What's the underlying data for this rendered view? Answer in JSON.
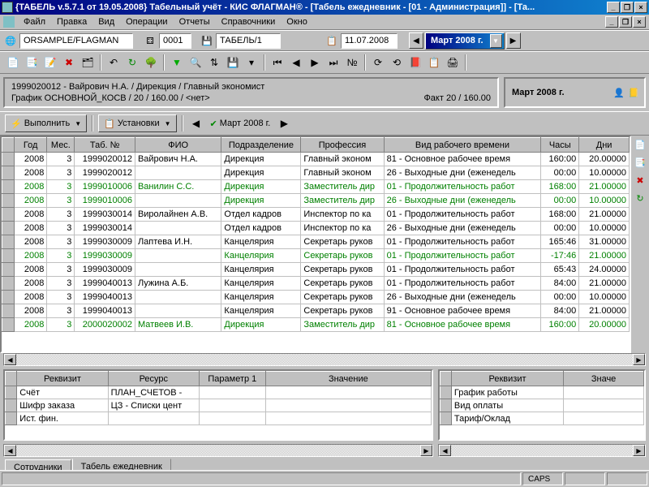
{
  "titlebar": {
    "text": "{ТАБЕЛЬ v.5.7.1 от 19.05.2008} Табельный учёт - КИС ФЛАГМАН® - [Табель ежедневник - [01 - Администрация]] - [Та..."
  },
  "menu": {
    "file": "Файл",
    "edit": "Правка",
    "view": "Вид",
    "ops": "Операции",
    "reports": "Отчеты",
    "refs": "Справочники",
    "window": "Окно"
  },
  "toolbar1": {
    "db": "ORSAMPLE/FLAGMAN",
    "code": "0001",
    "path": "ТАБЕЛЬ/1",
    "date": "11.07.2008",
    "period": "Март 2008 г."
  },
  "info": {
    "line1": "1999020012 - Вайрович Н.А.   /   Дирекция   /   Главный экономист",
    "line2": "График ОСНОВНОЙ_КОСВ / 20 / 160.00 / <нет>",
    "fact": "Факт 20 / 160.00",
    "period": "Март 2008 г."
  },
  "actions": {
    "execute": "Выполнить",
    "settings": "Установки",
    "month": "Март 2008 г."
  },
  "grid": {
    "headers": [
      "Год",
      "Мес.",
      "Таб. №",
      "ФИО",
      "Подразделение",
      "Профессия",
      "Вид рабочего времени",
      "Часы",
      "Дни"
    ],
    "rows": [
      {
        "g": false,
        "c": [
          "2008",
          "3",
          "1999020012",
          "Вайрович Н.А.",
          "Дирекция",
          "Главный эконом",
          "81 - Основное рабочее время",
          "160:00",
          "20.00000"
        ]
      },
      {
        "g": false,
        "c": [
          "2008",
          "3",
          "1999020012",
          "",
          "Дирекция",
          "Главный эконом",
          "26 - Выходные дни (еженедель",
          "00:00",
          "10.00000"
        ]
      },
      {
        "g": true,
        "c": [
          "2008",
          "3",
          "1999010006",
          "Ванилин С.С.",
          "Дирекция",
          "Заместитель дир",
          "01 - Продолжительность работ",
          "168:00",
          "21.00000"
        ]
      },
      {
        "g": true,
        "c": [
          "2008",
          "3",
          "1999010006",
          "",
          "Дирекция",
          "Заместитель дир",
          "26 - Выходные дни (еженедель",
          "00:00",
          "10.00000"
        ]
      },
      {
        "g": false,
        "c": [
          "2008",
          "3",
          "1999030014",
          "Виролайнен А.В.",
          "Отдел кадров",
          "Инспектор по ка",
          "01 - Продолжительность работ",
          "168:00",
          "21.00000"
        ]
      },
      {
        "g": false,
        "c": [
          "2008",
          "3",
          "1999030014",
          "",
          "Отдел кадров",
          "Инспектор по ка",
          "26 - Выходные дни (еженедель",
          "00:00",
          "10.00000"
        ]
      },
      {
        "g": false,
        "c": [
          "2008",
          "3",
          "1999030009",
          "Лаптева И.Н.",
          "Канцелярия",
          "Секретарь руков",
          "01 - Продолжительность работ",
          "165:46",
          "31.00000"
        ]
      },
      {
        "g": true,
        "c": [
          "2008",
          "3",
          "1999030009",
          "",
          "Канцелярия",
          "Секретарь руков",
          "01 - Продолжительность работ",
          "-17:46",
          "21.00000"
        ]
      },
      {
        "g": false,
        "c": [
          "2008",
          "3",
          "1999030009",
          "",
          "Канцелярия",
          "Секретарь руков",
          "01 - Продолжительность работ",
          "65:43",
          "24.00000"
        ]
      },
      {
        "g": false,
        "c": [
          "2008",
          "3",
          "1999040013",
          "Лужина А.Б.",
          "Канцелярия",
          "Секретарь руков",
          "01 - Продолжительность работ",
          "84:00",
          "21.00000"
        ]
      },
      {
        "g": false,
        "c": [
          "2008",
          "3",
          "1999040013",
          "",
          "Канцелярия",
          "Секретарь руков",
          "26 - Выходные дни (еженедель",
          "00:00",
          "10.00000"
        ]
      },
      {
        "g": false,
        "c": [
          "2008",
          "3",
          "1999040013",
          "",
          "Канцелярия",
          "Секретарь руков",
          "91 - Основное рабочее время ",
          "84:00",
          "21.00000"
        ]
      },
      {
        "g": true,
        "c": [
          "2008",
          "3",
          "2000020002",
          "Матвеев И.В.",
          "Дирекция",
          "Заместитель дир",
          "81 - Основное рабочее время",
          "160:00",
          "20.00000"
        ]
      }
    ]
  },
  "bottom_left": {
    "headers": [
      "Реквизит",
      "Ресурс",
      "Параметр 1",
      "Значение"
    ],
    "rows": [
      [
        "Счёт",
        "ПЛАН_СЧЕТОВ -",
        "",
        ""
      ],
      [
        "Шифр заказа",
        "ЦЗ - Списки цент",
        "",
        ""
      ],
      [
        "Ист. фин.",
        "",
        "",
        ""
      ]
    ]
  },
  "bottom_right": {
    "headers": [
      "Реквизит",
      "Значе"
    ],
    "rows": [
      [
        "График работы",
        ""
      ],
      [
        "Вид оплаты",
        ""
      ],
      [
        "Тариф/Оклад",
        ""
      ]
    ]
  },
  "tabs": {
    "t1": "Сотрудники",
    "t2": "Табель ежедневник"
  },
  "status": {
    "caps": "CAPS"
  }
}
